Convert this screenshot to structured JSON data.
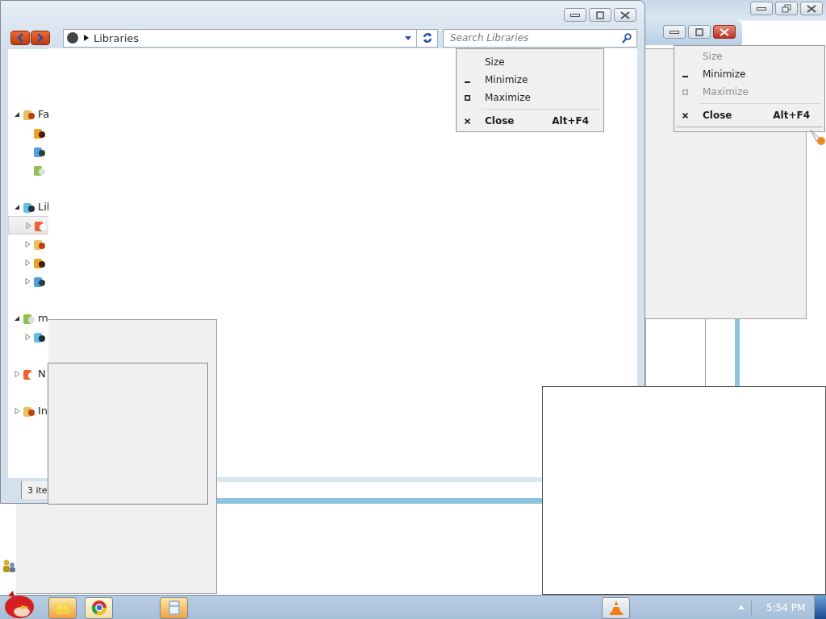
{
  "explorer": {
    "address": "Libraries",
    "search": {
      "placeholder": "Search Libraries"
    },
    "nav_tree": [
      {
        "label": "Fa",
        "expanded": true,
        "selected": false,
        "children": [
          {
            "selected": false
          },
          {
            "selected": false
          },
          {
            "selected": false
          }
        ]
      },
      {
        "label": "Lil",
        "expanded": true,
        "selected": false,
        "children": [
          {
            "expanded": false,
            "selected": true
          },
          {
            "expanded": false,
            "selected": false
          },
          {
            "expanded": false,
            "selected": false
          },
          {
            "expanded": false,
            "selected": false
          }
        ]
      },
      {
        "label": "m",
        "expanded": true,
        "selected": false,
        "children": [
          {
            "expanded": false,
            "selected": false
          }
        ]
      },
      {
        "label": "N",
        "expanded": false,
        "selected": false
      },
      {
        "label": "In",
        "expanded": false,
        "selected": false
      }
    ],
    "status": "3 ite"
  },
  "menus": [
    {
      "items": [
        {
          "kind": "size",
          "label": "Size",
          "disabled": false,
          "default": false
        },
        {
          "kind": "minimize",
          "label": "Minimize",
          "disabled": false,
          "default": false
        },
        {
          "kind": "maximize",
          "label": "Maximize",
          "disabled": false,
          "default": false
        },
        {
          "kind": "close",
          "label": "Close",
          "shortcut": "Alt+F4",
          "disabled": false,
          "default": true
        }
      ]
    },
    {
      "items": [
        {
          "kind": "size",
          "label": "Size",
          "disabled": true,
          "default": false
        },
        {
          "kind": "minimize",
          "label": "Minimize",
          "disabled": false,
          "default": false
        },
        {
          "kind": "maximize",
          "label": "Maximize",
          "disabled": true,
          "default": false
        },
        {
          "kind": "close",
          "label": "Close",
          "shortcut": "Alt+F4",
          "disabled": false,
          "default": true
        }
      ]
    }
  ],
  "taskbar": {
    "buttons": [
      {
        "kind": "folder"
      },
      {
        "kind": "browser"
      },
      {
        "kind": "calculator"
      },
      {
        "kind": "cone"
      }
    ],
    "clock": "5:54 PM"
  }
}
